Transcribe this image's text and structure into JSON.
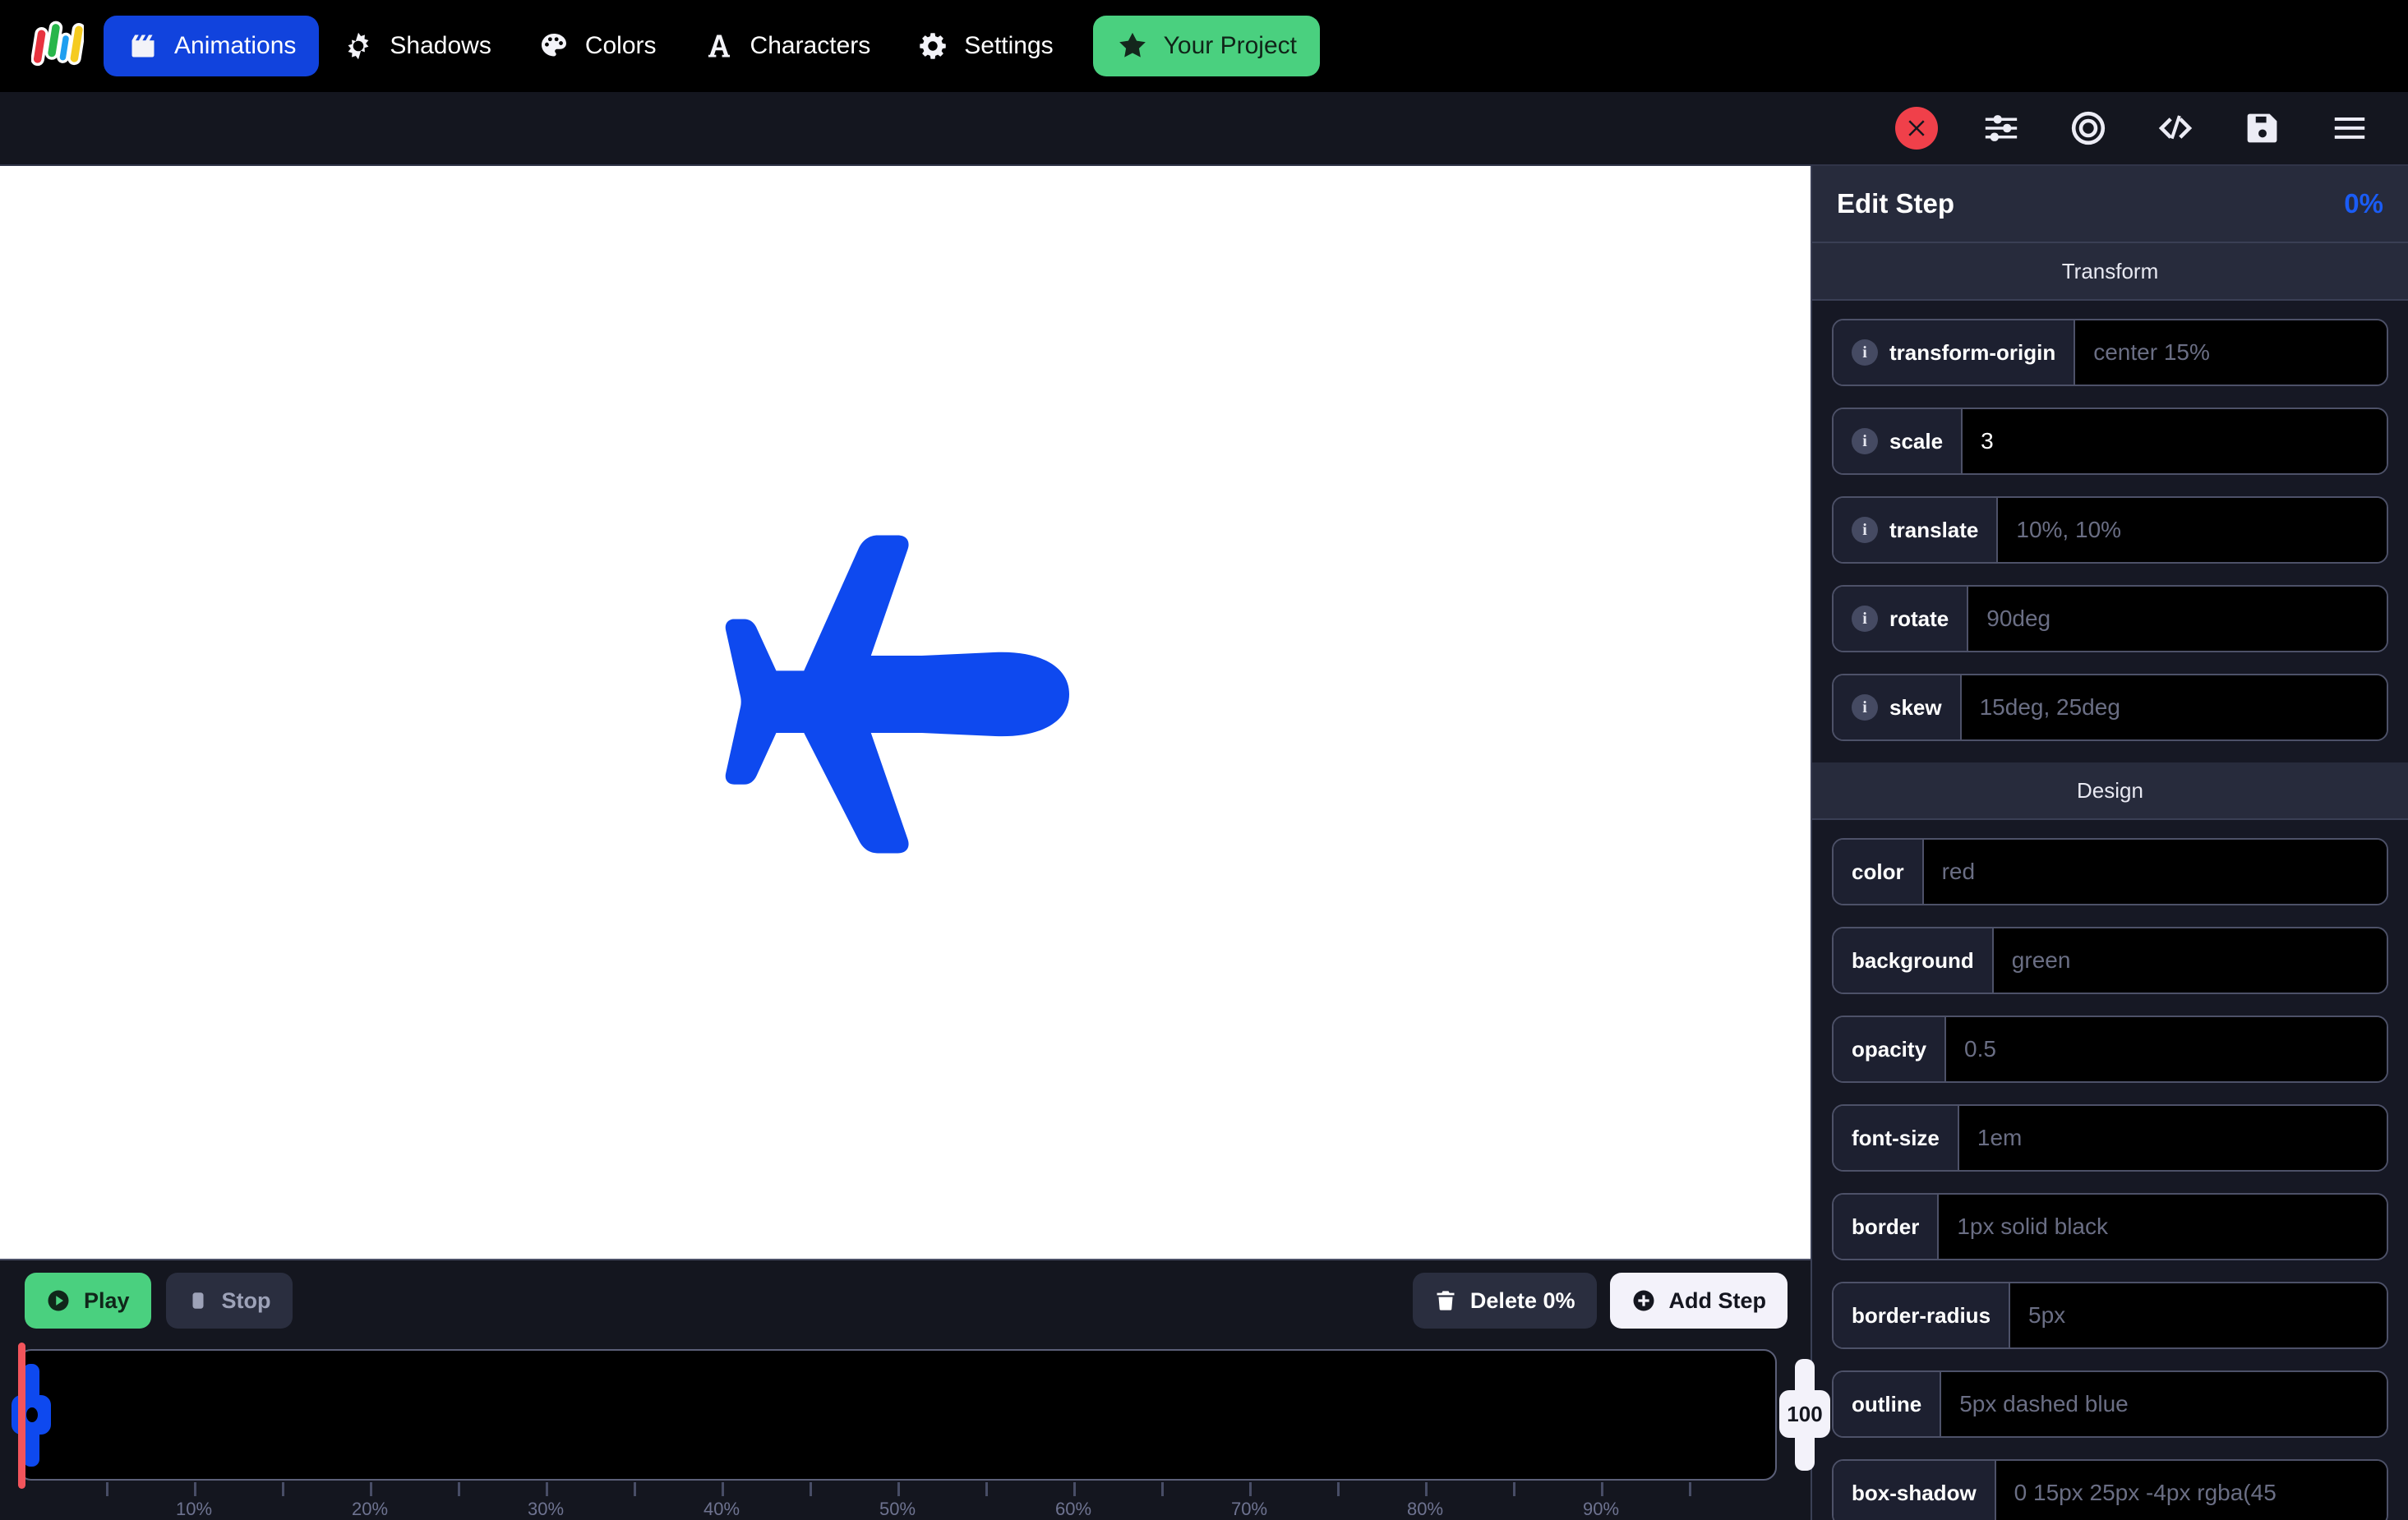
{
  "nav": {
    "logo_icon": "bars-logo-icon",
    "logo_colors": [
      "#e8333f",
      "#27b64a",
      "#1f9ff0",
      "#f5cb20"
    ],
    "tabs": [
      {
        "label": "Animations",
        "icon": "clapperboard-icon",
        "active": true
      },
      {
        "label": "Shadows",
        "icon": "sunburst-icon",
        "active": false
      },
      {
        "label": "Colors",
        "icon": "palette-icon",
        "active": false
      },
      {
        "label": "Characters",
        "icon": "letter-a-icon",
        "active": false
      },
      {
        "label": "Settings",
        "icon": "gear-icon",
        "active": false
      }
    ],
    "project": {
      "label": "Your Project",
      "icon": "star-icon",
      "color": "#4ad07f"
    }
  },
  "toolbar": {
    "buttons": [
      {
        "name": "close-icon",
        "label": "Close"
      },
      {
        "name": "sliders-icon",
        "label": "Settings"
      },
      {
        "name": "target-icon",
        "label": "Target"
      },
      {
        "name": "code-icon",
        "label": "Code"
      },
      {
        "name": "save-icon",
        "label": "Save"
      },
      {
        "name": "menu-icon",
        "label": "Menu"
      }
    ],
    "close_color": "#f0404a"
  },
  "canvas": {
    "element_icon": "airplane-icon",
    "element_color": "#0e49ef",
    "background": "#ffffff"
  },
  "timeline": {
    "play_label": "Play",
    "stop_label": "Stop",
    "delete_label": "Delete 0%",
    "add_step_label": "Add Step",
    "playhead_percent": 0,
    "playhead_color": "#f2545b",
    "step_marker_percent": 0,
    "step_marker_color": "#0e49ef",
    "end_marker_label": "100",
    "tick_step": 5,
    "tick_labels": [
      "10%",
      "20%",
      "30%",
      "40%",
      "50%",
      "60%",
      "70%",
      "80%",
      "90%"
    ]
  },
  "panel": {
    "title": "Edit Step",
    "percent": "0%",
    "percent_color": "#1a5cf5",
    "sections": [
      {
        "name": "Transform",
        "fields": [
          {
            "label": "transform-origin",
            "value": "",
            "placeholder": "center 15%",
            "info": true
          },
          {
            "label": "scale",
            "value": "3",
            "placeholder": "",
            "info": true
          },
          {
            "label": "translate",
            "value": "",
            "placeholder": "10%, 10%",
            "info": true
          },
          {
            "label": "rotate",
            "value": "",
            "placeholder": "90deg",
            "info": true
          },
          {
            "label": "skew",
            "value": "",
            "placeholder": "15deg, 25deg",
            "info": true
          }
        ]
      },
      {
        "name": "Design",
        "fields": [
          {
            "label": "color",
            "value": "",
            "placeholder": "red",
            "info": false
          },
          {
            "label": "background",
            "value": "",
            "placeholder": "green",
            "info": false
          },
          {
            "label": "opacity",
            "value": "",
            "placeholder": "0.5",
            "info": false
          },
          {
            "label": "font-size",
            "value": "",
            "placeholder": "1em",
            "info": false
          },
          {
            "label": "border",
            "value": "",
            "placeholder": "1px solid black",
            "info": false
          },
          {
            "label": "border-radius",
            "value": "",
            "placeholder": "5px",
            "info": false
          },
          {
            "label": "outline",
            "value": "",
            "placeholder": "5px dashed blue",
            "info": false
          },
          {
            "label": "box-shadow",
            "value": "",
            "placeholder": "0 15px 25px -4px rgba(45",
            "info": false
          }
        ]
      }
    ]
  }
}
